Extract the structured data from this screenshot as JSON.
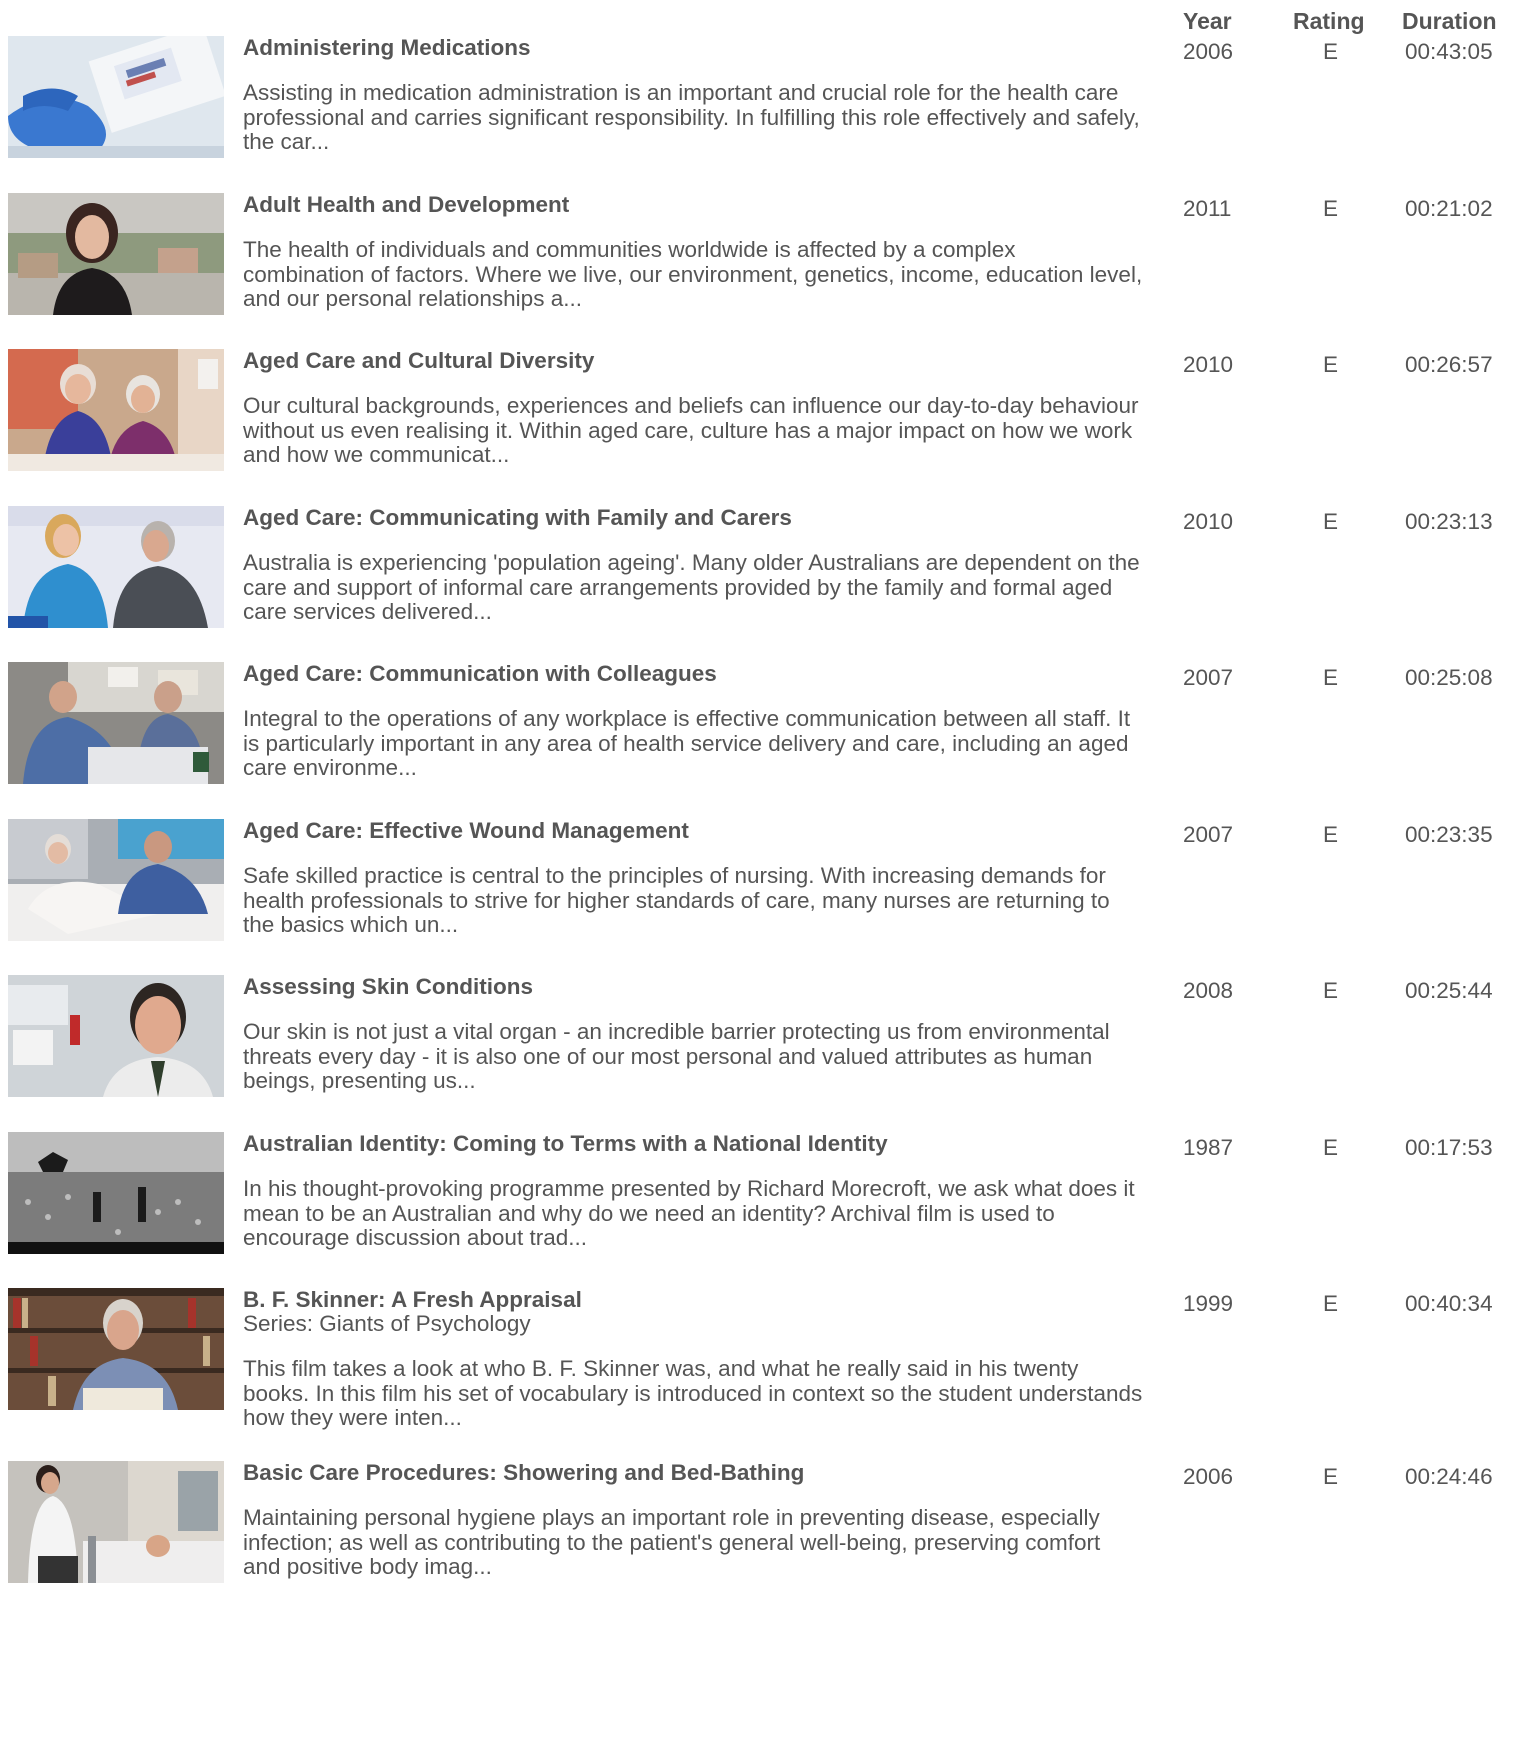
{
  "headers": {
    "year": "Year",
    "rating": "Rating",
    "duration": "Duration"
  },
  "items": [
    {
      "title": "Administering Medications",
      "series": "",
      "description": "Assisting in medication administration is an important and crucial role for the health care professional and carries significant responsibility. In fulfilling this role effectively and safely, the car...",
      "year": "2006",
      "rating": "E",
      "duration": "00:43:05",
      "thumb_icon": "medical-supplies-thumbnail"
    },
    {
      "title": "Adult Health and Development",
      "series": "",
      "description": "The health of individuals and communities worldwide is affected by a complex combination of factors. Where we live, our environment, genetics, income, education level, and our personal relationships a...",
      "year": "2011",
      "rating": "E",
      "duration": "00:21:02",
      "thumb_icon": "presenter-thumbnail"
    },
    {
      "title": "Aged Care and Cultural Diversity",
      "series": "",
      "description": "Our cultural backgrounds, experiences and beliefs can influence our day-to-day behaviour without us even realising it. Within aged care, culture has a major impact on how we work and how we communicat...",
      "year": "2010",
      "rating": "E",
      "duration": "00:26:57",
      "thumb_icon": "elderly-women-thumbnail"
    },
    {
      "title": "Aged Care: Communicating with Family and Carers",
      "series": "",
      "description": "Australia is experiencing 'population ageing'. Many older Australians are dependent on the care and support of informal care arrangements provided by the family and formal aged care services delivered...",
      "year": "2010",
      "rating": "E",
      "duration": "00:23:13",
      "thumb_icon": "conversation-thumbnail"
    },
    {
      "title": "Aged Care: Communication with Colleagues",
      "series": "",
      "description": "Integral to the operations of any workplace is effective communication between all staff. It is particularly important in any area of health service delivery and care, including an aged care environme...",
      "year": "2007",
      "rating": "E",
      "duration": "00:25:08",
      "thumb_icon": "colleagues-thumbnail"
    },
    {
      "title": "Aged Care: Effective Wound Management",
      "series": "",
      "description": "Safe skilled practice is central to the principles of nursing. With increasing demands for health professionals to strive for higher standards of care, many nurses are returning to the basics which un...",
      "year": "2007",
      "rating": "E",
      "duration": "00:23:35",
      "thumb_icon": "wound-care-thumbnail"
    },
    {
      "title": "Assessing Skin Conditions",
      "series": "",
      "description": "Our skin is not just a vital organ - an incredible barrier protecting us from environmental threats every day - it is also one of our most personal and valued attributes as human beings, presenting us...",
      "year": "2008",
      "rating": "E",
      "duration": "00:25:44",
      "thumb_icon": "doctor-thumbnail"
    },
    {
      "title": "Australian Identity: Coming to Terms with a National Identity",
      "series": "",
      "description": "In his thought-provoking programme presented by Richard Morecroft, we ask what does it mean to be an Australian and why do we need an identity? Archival film is used to encourage discussion about trad...",
      "year": "1987",
      "rating": "E",
      "duration": "00:17:53",
      "thumb_icon": "archival-film-thumbnail"
    },
    {
      "title": "B. F. Skinner: A Fresh Appraisal",
      "series": "Series: Giants of Psychology",
      "description": "This film takes a look at who B. F. Skinner was, and what he really said in his twenty books. In this film his set of vocabulary is introduced in context so the student understands how they were inten...",
      "year": "1999",
      "rating": "E",
      "duration": "00:40:34",
      "thumb_icon": "library-speaker-thumbnail"
    },
    {
      "title": "Basic Care Procedures: Showering and Bed-Bathing",
      "series": "",
      "description": "Maintaining personal hygiene plays an important role in preventing disease, especially infection; as well as contributing to the patient's general well-being, preserving comfort and positive body imag...",
      "year": "2006",
      "rating": "E",
      "duration": "00:24:46",
      "thumb_icon": "nurse-bed-thumbnail"
    }
  ]
}
